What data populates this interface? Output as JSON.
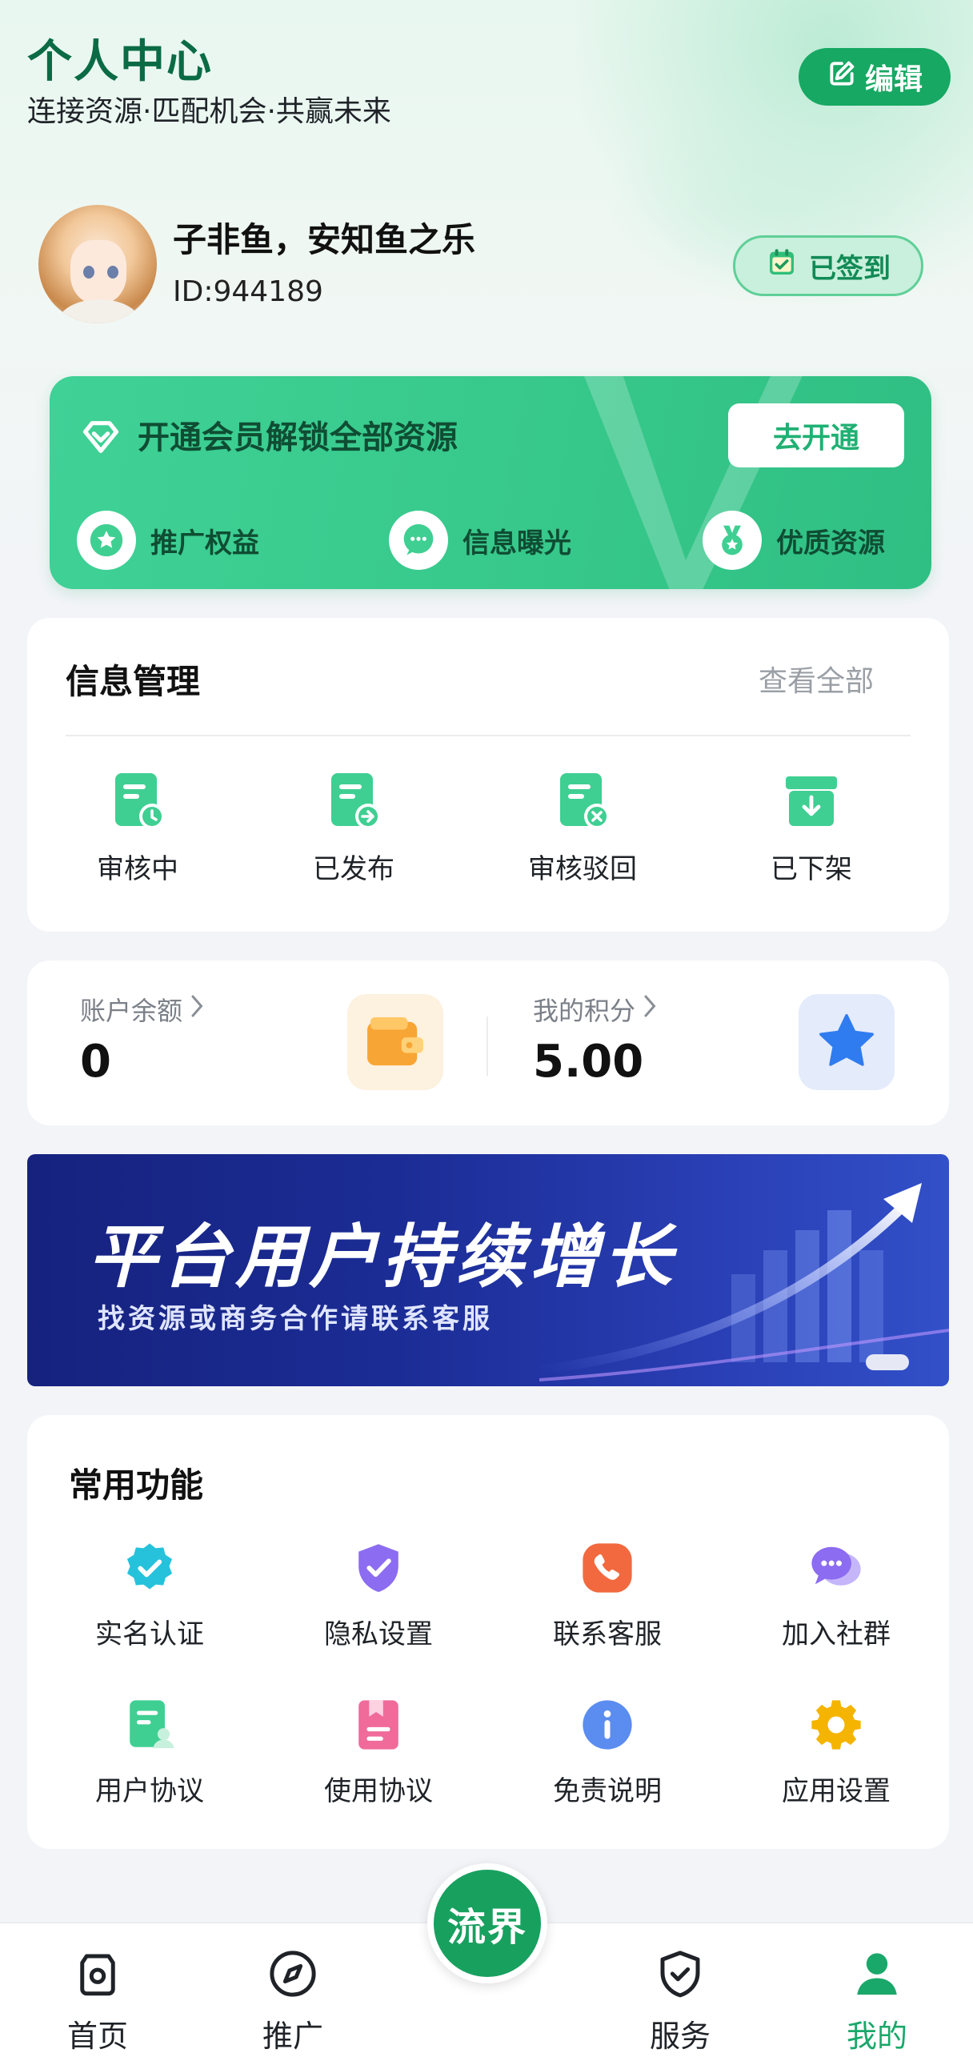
{
  "header": {
    "title": "个人中心",
    "subtitle": "连接资源·匹配机会·共赢未来",
    "edit_label": "编辑"
  },
  "profile": {
    "nickname": "子非鱼，安知鱼之乐",
    "user_id": "ID:944189",
    "sign_status": "已签到"
  },
  "vip": {
    "title": "开通会员解锁全部资源",
    "button": "去开通",
    "perks": [
      "推广权益",
      "信息曝光",
      "优质资源"
    ]
  },
  "info_management": {
    "title": "信息管理",
    "view_all": "查看全部",
    "items": [
      "审核中",
      "已发布",
      "审核驳回",
      "已下架"
    ]
  },
  "account": {
    "balance_label": "账户余额",
    "balance_value": "0",
    "points_label": "我的积分",
    "points_value": "5.00"
  },
  "banner": {
    "title": "平台用户持续增长",
    "subtitle": "找资源或商务合作请联系客服"
  },
  "functions": {
    "title": "常用功能",
    "items": [
      "实名认证",
      "隐私设置",
      "联系客服",
      "加入社群",
      "用户协议",
      "使用协议",
      "免责说明",
      "应用设置"
    ]
  },
  "bottom_nav": {
    "items": [
      "首页",
      "推广",
      "服务",
      "我的"
    ],
    "center": "流界",
    "active": "我的"
  },
  "colors": {
    "brand": "#17a863",
    "brand_dark": "#0a6b45",
    "vip_card": "#3fd196",
    "banner": "#1b2c95"
  }
}
